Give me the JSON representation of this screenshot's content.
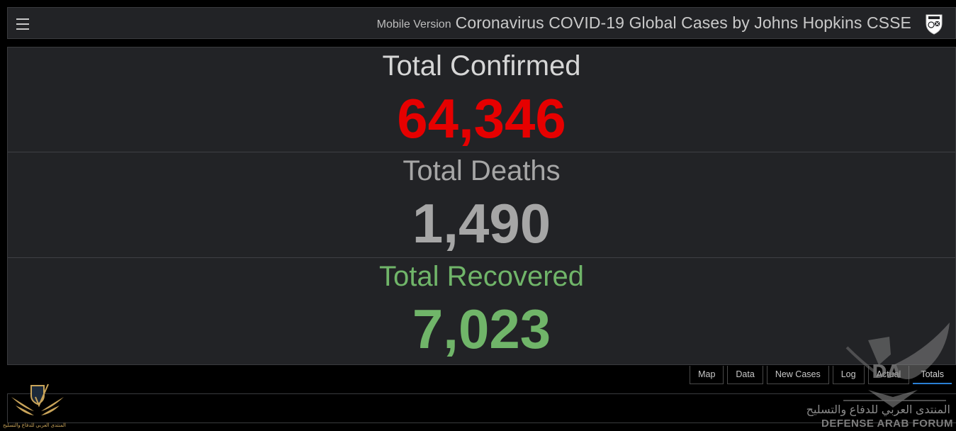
{
  "header": {
    "menu_icon": "hamburger-icon",
    "mobile_link": "Mobile Version",
    "title": "Coronavirus COVID-19 Global Cases by Johns Hopkins CSSE",
    "logo_icon": "jhu-shield-icon"
  },
  "stats": {
    "confirmed": {
      "label": "Total Confirmed",
      "value": "64,346",
      "color": "#e60000",
      "label_color": "#d6d6d6"
    },
    "deaths": {
      "label": "Total Deaths",
      "value": "1,490",
      "color": "#a6a6a6",
      "label_color": "#a6a6a6"
    },
    "recovered": {
      "label": "Total Recovered",
      "value": "7,023",
      "color": "#70b569",
      "label_color": "#70b569"
    }
  },
  "tabs": [
    {
      "label": "Map",
      "active": false
    },
    {
      "label": "Data",
      "active": false
    },
    {
      "label": "New Cases",
      "active": false
    },
    {
      "label": "Log",
      "active": false
    },
    {
      "label": "Actual",
      "active": false
    },
    {
      "label": "Totals",
      "active": true
    }
  ],
  "watermark": {
    "left_arabic": "المنتدى العربي للدفاع والتسليح",
    "right_arabic": "المنتدى العربي للدفاع والتسليح",
    "right_english": "DEFENSE ARAB FORUM"
  },
  "colors": {
    "accent": "#2a7fd4",
    "panel_bg": "#222326",
    "page_bg": "#000000"
  }
}
